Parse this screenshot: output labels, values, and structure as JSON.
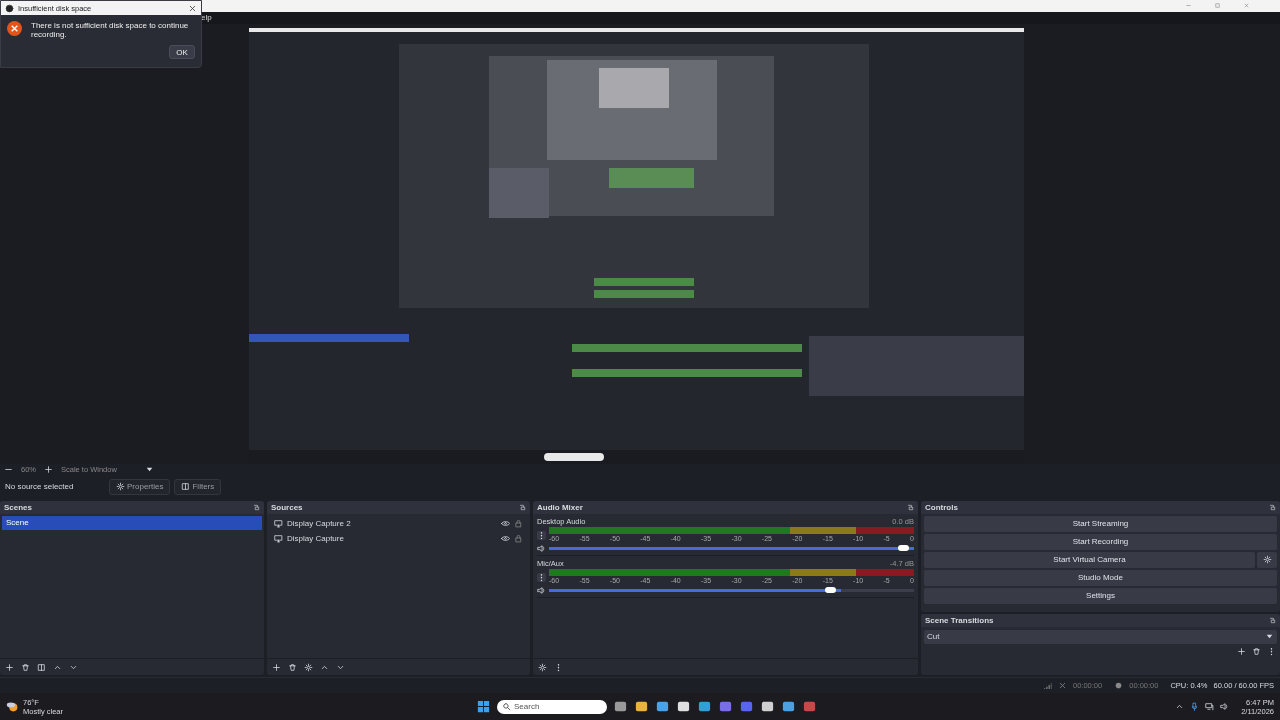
{
  "window": {
    "menu_text": "elp"
  },
  "dialog": {
    "title": "Insufficient disk space",
    "message": "There is not sufficient disk space to continue recording.",
    "button": "OK"
  },
  "zoom_bar": {
    "zoom": "60%",
    "scale_mode": "Scale to Window"
  },
  "source_bar": {
    "label": "No source selected",
    "buttons": [
      "Properties",
      "Filters"
    ]
  },
  "scenes": {
    "title": "Scenes",
    "items": [
      {
        "name": "Scene",
        "selected": true
      }
    ]
  },
  "sources": {
    "title": "Sources",
    "items": [
      {
        "name": "Display Capture 2",
        "visible": true
      },
      {
        "name": "Display Capture",
        "visible": true
      }
    ]
  },
  "audio_mixer": {
    "title": "Audio Mixer",
    "channels": [
      {
        "name": "Desktop Audio",
        "reading": "0.0 dB",
        "level": 1.0,
        "scale": [
          "-60",
          "-55",
          "-50",
          "-45",
          "-40",
          "-35",
          "-30",
          "-25",
          "-20",
          "-15",
          "-10",
          "-5",
          "0"
        ]
      },
      {
        "name": "Mic/Aux",
        "reading": "-4.7 dB",
        "level": 0.8,
        "scale": [
          "-60",
          "-55",
          "-50",
          "-45",
          "-40",
          "-35",
          "-30",
          "-25",
          "-20",
          "-15",
          "-10",
          "-5",
          "0"
        ]
      }
    ]
  },
  "controls": {
    "title": "Controls",
    "buttons": [
      {
        "label": "Start Streaming",
        "kind": "plain"
      },
      {
        "label": "Start Recording",
        "kind": "plain"
      },
      {
        "label": "Start Virtual Camera",
        "kind": "with_settings"
      },
      {
        "label": "Studio Mode",
        "kind": "plain"
      },
      {
        "label": "Settings",
        "kind": "plain"
      }
    ]
  },
  "scene_transitions": {
    "title": "Scene Transitions",
    "transition": "Cut"
  },
  "status_bar": {
    "stream_time": "00:00:00",
    "record_time": "00:00:00",
    "cpu": "CPU: 0.4%",
    "fps": "60.00 / 60.00 FPS"
  },
  "taskbar": {
    "weather_temp": "76°F",
    "weather_text": "Mostly clear",
    "search_placeholder": "Search",
    "time": "6:47 PM",
    "date": "2/11/2026"
  }
}
